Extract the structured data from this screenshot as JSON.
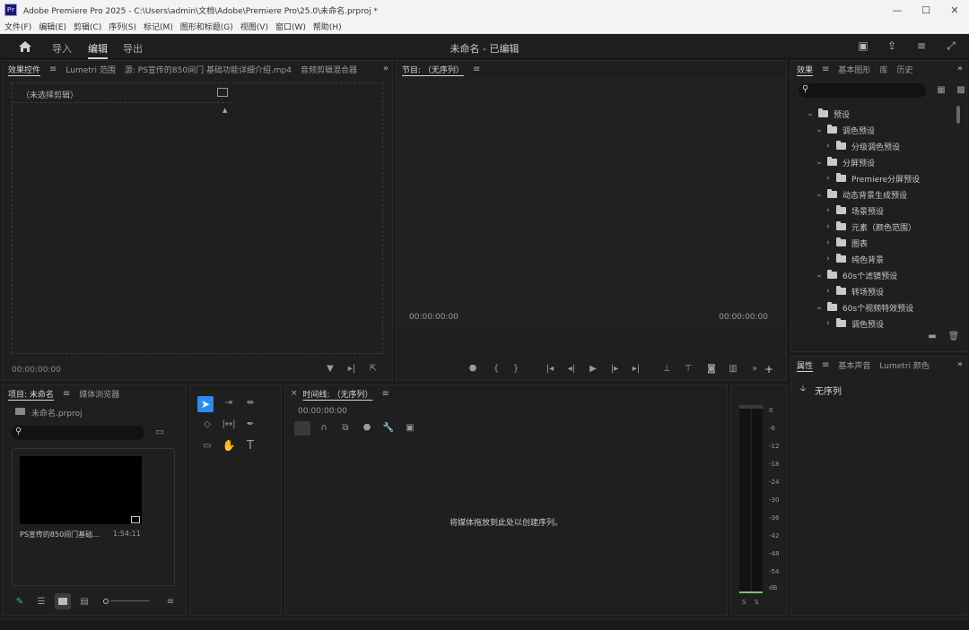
{
  "window": {
    "title": "Adobe Premiere Pro 2025 - C:\\Users\\admin\\文档\\Adobe\\Premiere Pro\\25.0\\未命名.prproj *",
    "app_logo": "Pr",
    "controls": {
      "minimize": "—",
      "maximize": "☐",
      "close": "✕"
    }
  },
  "menu": [
    "文件(F)",
    "编辑(E)",
    "剪辑(C)",
    "序列(S)",
    "标记(M)",
    "图形和标题(G)",
    "视图(V)",
    "窗口(W)",
    "帮助(H)"
  ],
  "header": {
    "tabs": [
      "导入",
      "编辑",
      "导出"
    ],
    "active_tab": "编辑",
    "document_title": "未命名 - 已编辑"
  },
  "source_panel": {
    "tabs": [
      "效果控件",
      "Lumetri 范围",
      "源: PS宣传的850间门 基础功能详细介绍.mp4",
      "音频剪辑混合器"
    ],
    "no_clip_label": "（未选择剪辑）",
    "timecode": "00:00:00:00"
  },
  "program_panel": {
    "tab": "节目: （无序列）",
    "timecode_left": "00:00:00:00",
    "timecode_right": "00:00:00:00"
  },
  "effects_panel": {
    "tabs": [
      "效果",
      "基本图形",
      "库",
      "历史"
    ],
    "tree": [
      {
        "level": 0,
        "expanded": true,
        "label": "预设"
      },
      {
        "level": 1,
        "expanded": true,
        "label": "调色预设"
      },
      {
        "level": 2,
        "expanded": false,
        "label": "分级调色预设"
      },
      {
        "level": 1,
        "expanded": true,
        "label": "分屏预设"
      },
      {
        "level": 2,
        "expanded": false,
        "label": "Premiere分屏预设"
      },
      {
        "level": 1,
        "expanded": true,
        "label": "动态背景生成预设"
      },
      {
        "level": 2,
        "expanded": false,
        "label": "场景预设"
      },
      {
        "level": 2,
        "expanded": false,
        "label": "元素（颜色范围）"
      },
      {
        "level": 2,
        "expanded": false,
        "label": "图表"
      },
      {
        "level": 2,
        "expanded": false,
        "label": "纯色背景"
      },
      {
        "level": 1,
        "expanded": true,
        "label": "60s个滤镜预设"
      },
      {
        "level": 2,
        "expanded": false,
        "label": "转场预设"
      },
      {
        "level": 1,
        "expanded": true,
        "label": "60s个视频特效预设"
      },
      {
        "level": 2,
        "expanded": false,
        "label": "调色预设"
      }
    ]
  },
  "properties_panel": {
    "tabs": [
      "属性",
      "基本声音",
      "Lumetri 颜色"
    ],
    "no_sequence_label": "无序列"
  },
  "project_panel": {
    "tabs": [
      "项目: 未命名",
      "媒体浏览器"
    ],
    "project_file": "未命名.prproj",
    "clip_name": "PS宣传的850间门基础...",
    "clip_duration": "1:54:11"
  },
  "timeline_panel": {
    "tab": "时间线: （无序列）",
    "timecode": "00:00:00:00",
    "drop_message": "将媒体拖放到此处以创建序列。"
  },
  "audio_meter": {
    "labels": [
      "0",
      "-6",
      "-12",
      "-18",
      "-24",
      "-30",
      "-36",
      "-42",
      "-48",
      "-54",
      "dB"
    ],
    "footer": [
      "S",
      "S"
    ]
  },
  "colors": {
    "panel_bg": "#1f1f1f",
    "selection_blue": "#2d8ceb",
    "pencil_green": "#3dbd7d"
  }
}
